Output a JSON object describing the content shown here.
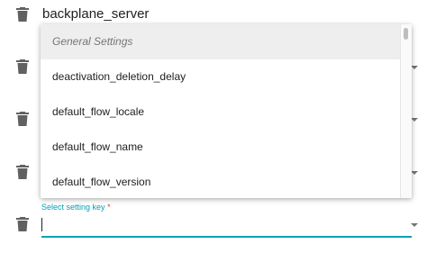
{
  "rows": [
    {
      "value": "backplane_server"
    },
    {
      "value": ""
    },
    {
      "value": ""
    },
    {
      "value": ""
    }
  ],
  "dropdown": {
    "group_label": "General Settings",
    "options": [
      "deactivation_deletion_delay",
      "default_flow_locale",
      "default_flow_name",
      "default_flow_version"
    ]
  },
  "new_key": {
    "label": "Select setting key",
    "required_mark": "*",
    "value": ""
  },
  "colors": {
    "accent": "#00a3b4",
    "required": "#e53935"
  },
  "icons": [
    "delete-icon",
    "dropdown-arrow-icon"
  ]
}
